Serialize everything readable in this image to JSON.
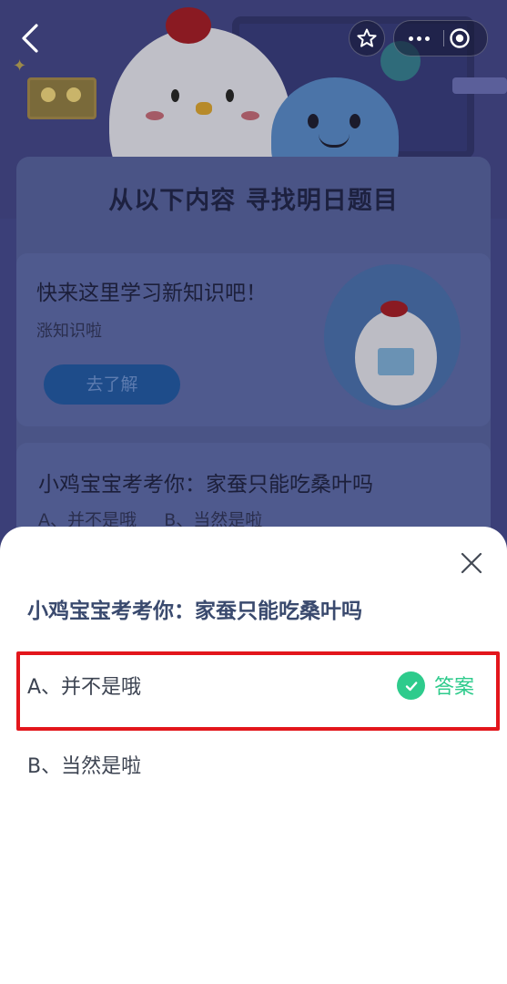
{
  "colors": {
    "accent_green": "#2ecb8c",
    "highlight_red": "#e3161c",
    "question_text": "#3a4a6e",
    "hero_background": "#3a3d74"
  },
  "nav": {
    "back_icon": "chevron-left-icon",
    "favorite_icon": "star-icon",
    "more_icon": "more-dots-icon",
    "close_icon": "target-circle-icon"
  },
  "background_page": {
    "section_title": "从以下内容  寻找明日题目",
    "learn_card": {
      "title": "快来这里学习新知识吧！",
      "subtitle": "涨知识啦",
      "button_label": "去了解"
    },
    "quiz_card": {
      "question": "小鸡宝宝考考你：家蚕只能吃桑叶吗",
      "options_preview": "A、并不是哦     B、当然是啦"
    }
  },
  "answer_sheet": {
    "close_icon": "close-icon",
    "question": "小鸡宝宝考考你：家蚕只能吃桑叶吗",
    "options": [
      {
        "label": "A、并不是哦",
        "is_answer": true
      },
      {
        "label": "B、当然是啦",
        "is_answer": false
      }
    ],
    "answer_badge_icon": "checkmark-circle-icon",
    "answer_badge_label": "答案"
  }
}
